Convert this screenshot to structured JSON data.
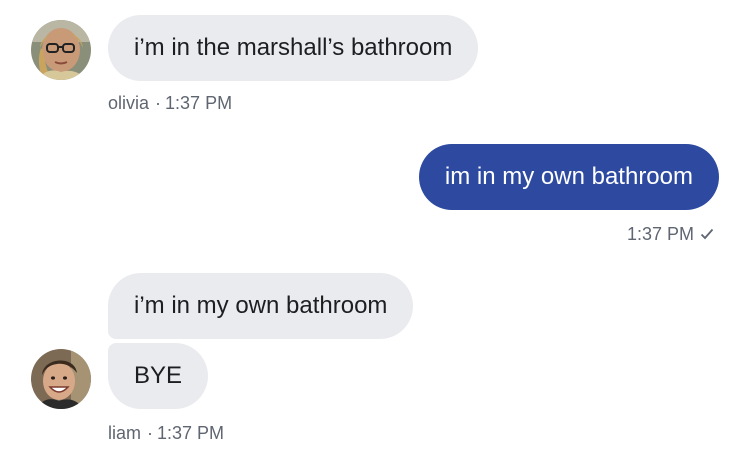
{
  "messages": [
    {
      "sender": "olivia",
      "direction": "incoming",
      "text": "i’m in the marshall’s bathroom",
      "time": "1:37 PM",
      "avatar_icon": "olivia-avatar"
    },
    {
      "sender": "me",
      "direction": "outgoing",
      "text": "im in my own bathroom",
      "time": "1:37 PM",
      "status_icon": "checkmark-icon"
    },
    {
      "sender": "liam",
      "direction": "incoming",
      "texts": [
        "i’m in my own bathroom",
        "BYE"
      ],
      "time": "1:37 PM",
      "avatar_icon": "liam-avatar"
    }
  ],
  "colors": {
    "incoming_bubble": "#e9ebee",
    "outgoing_bubble": "#2d4aa0",
    "meta_text": "#5f6671"
  }
}
